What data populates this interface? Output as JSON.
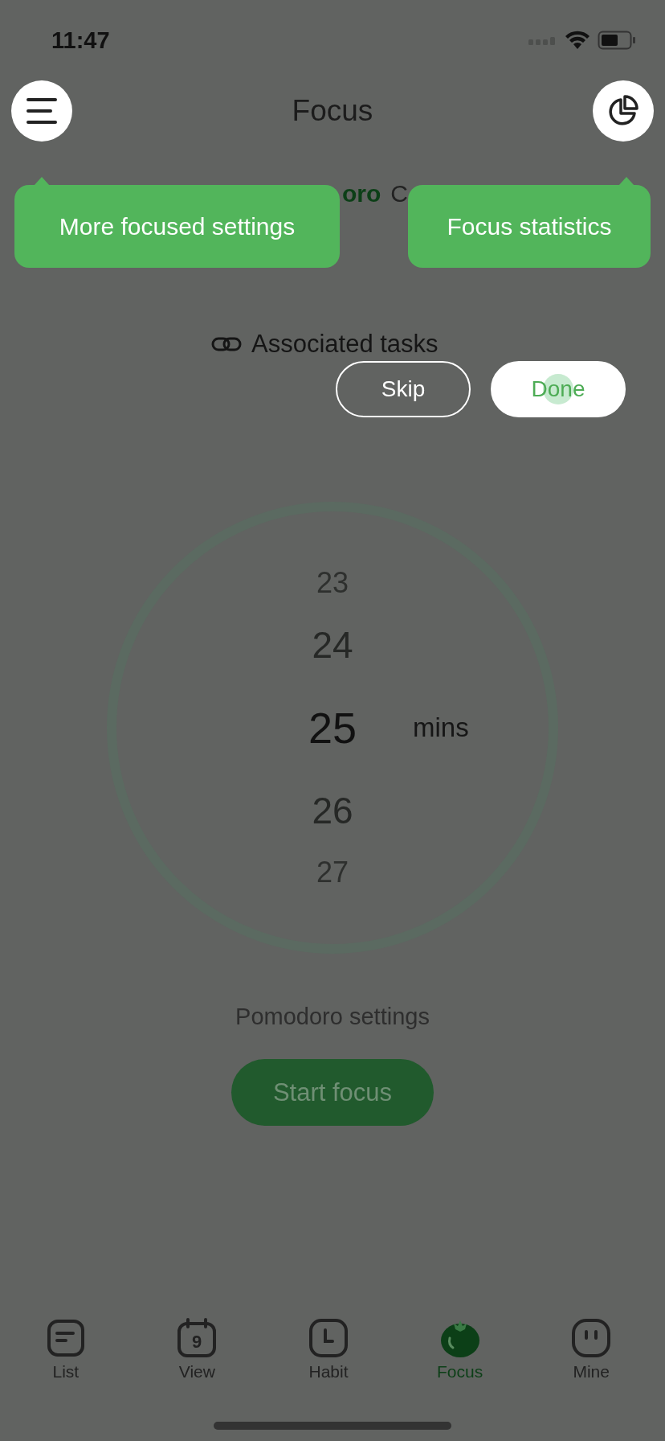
{
  "status_bar": {
    "time": "11:47"
  },
  "header": {
    "title": "Focus"
  },
  "mode_tabs": [
    {
      "label": "oro",
      "selected": true
    },
    {
      "label": "C",
      "selected": false
    }
  ],
  "tooltips": [
    {
      "text": "More focused settings"
    },
    {
      "text": "Focus statistics"
    }
  ],
  "associated_tasks": "Associated tasks",
  "coach_buttons": [
    {
      "label": "Skip",
      "kind": "outline"
    },
    {
      "label": "Done",
      "kind": "filled"
    }
  ],
  "picker": {
    "unit": "mins",
    "values": [
      {
        "label": "23",
        "selected": false
      },
      {
        "label": "24",
        "selected": false
      },
      {
        "label": "25",
        "selected": true
      },
      {
        "label": "26",
        "selected": false
      },
      {
        "label": "27",
        "selected": false
      }
    ]
  },
  "pomodoro_settings": "Pomodoro settings",
  "start_button": "Start focus",
  "tab_bar": [
    {
      "label": "List",
      "kind": "list",
      "selected": false
    },
    {
      "label": "View",
      "kind": "calendar",
      "badge": "9",
      "selected": false
    },
    {
      "label": "Habit",
      "kind": "clock",
      "selected": false
    },
    {
      "label": "Focus",
      "kind": "tomato",
      "selected": true
    },
    {
      "label": "Mine",
      "kind": "face",
      "selected": false
    }
  ]
}
